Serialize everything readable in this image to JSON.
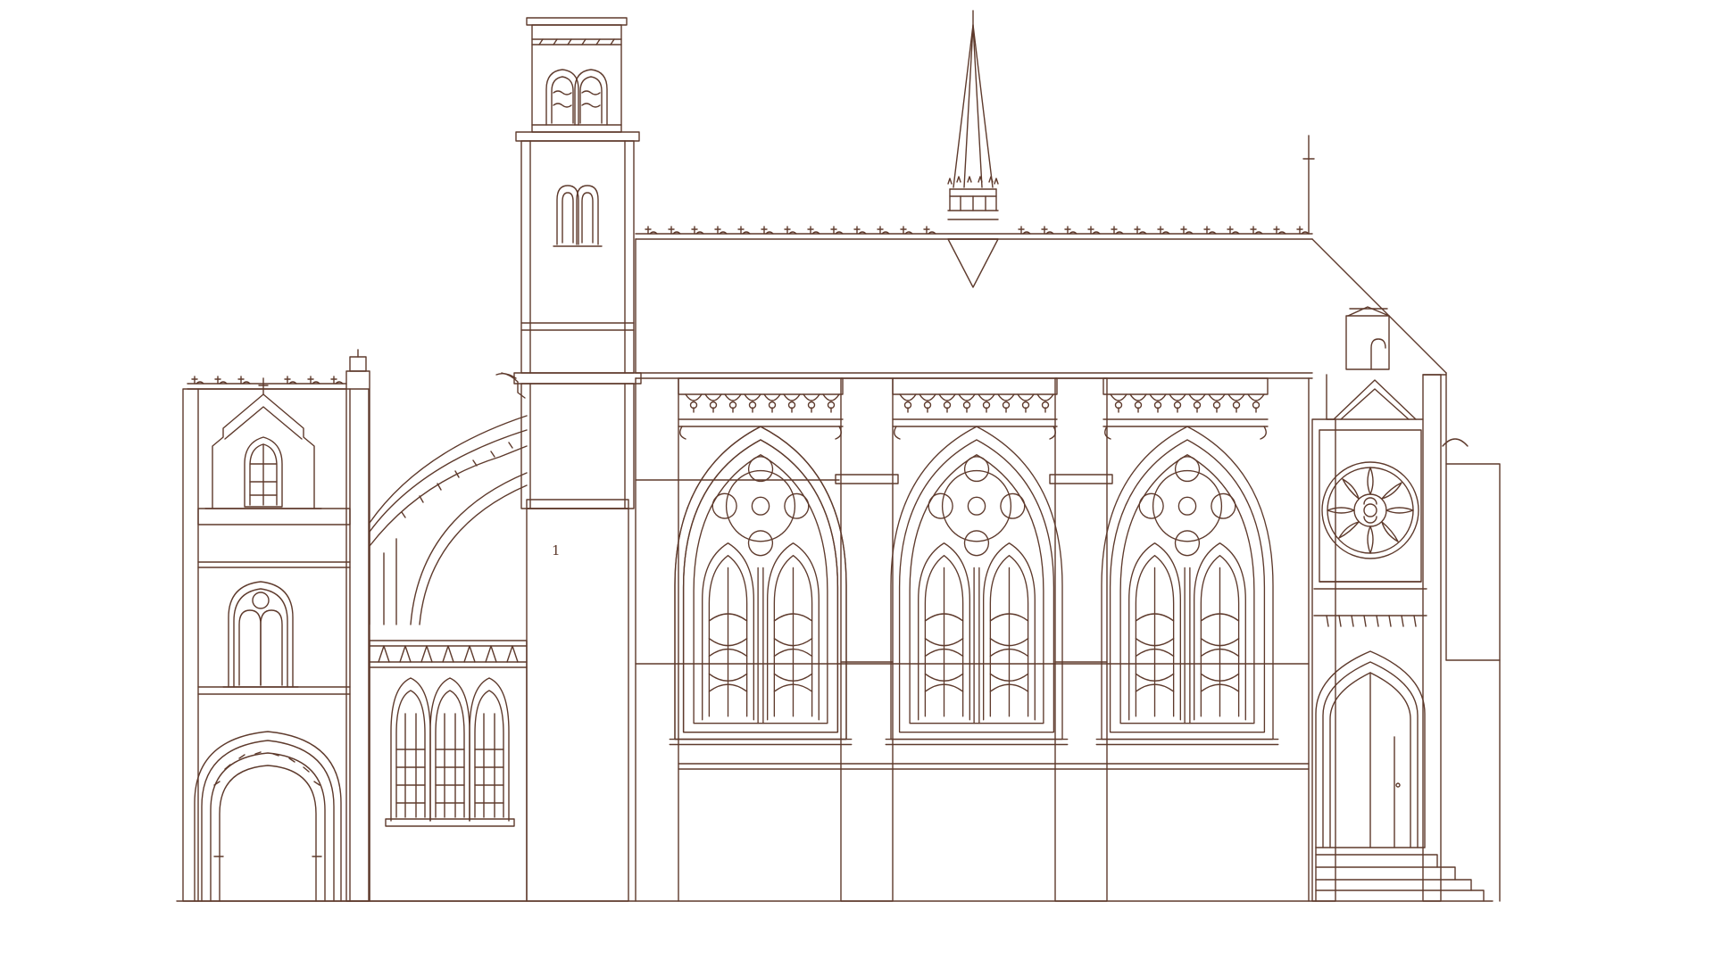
{
  "drawing": {
    "subject": "gothic-church-side-elevation",
    "ink_color": "#5e3a2c",
    "paper_color": "#ffffff",
    "tower_marker": "1",
    "elements": [
      "porch-building",
      "flying-buttress",
      "aisle-window",
      "bell-tower",
      "spire",
      "nave-roof",
      "nave-window",
      "buttress",
      "rose-window",
      "entrance-door",
      "entrance-steps"
    ]
  }
}
